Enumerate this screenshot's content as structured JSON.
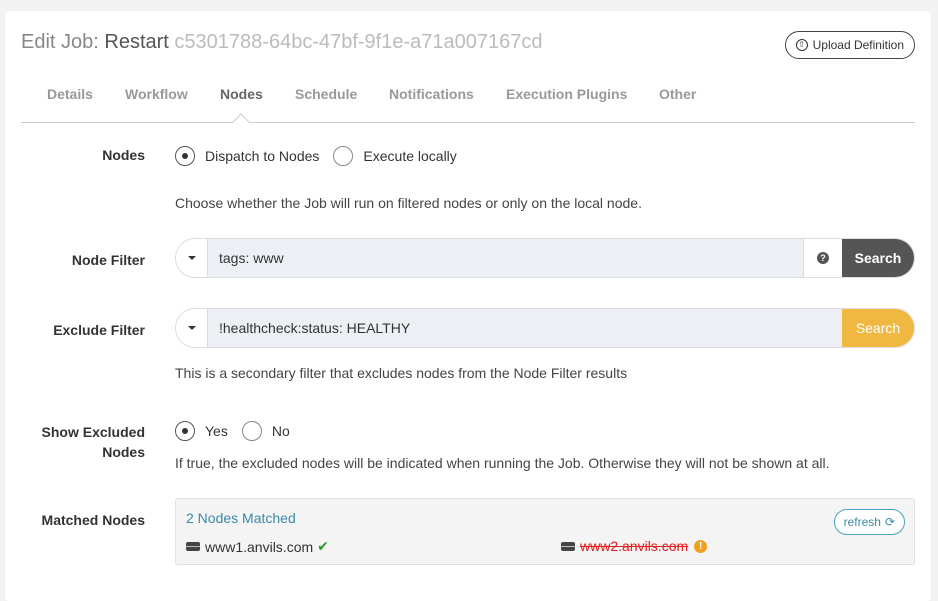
{
  "header": {
    "prefix": "Edit Job: ",
    "job_name": "Restart",
    "job_id": "c5301788-64bc-47bf-9f1e-a71a007167cd",
    "upload_label": "Upload Definition"
  },
  "tabs": [
    {
      "label": "Details"
    },
    {
      "label": "Workflow"
    },
    {
      "label": "Nodes"
    },
    {
      "label": "Schedule"
    },
    {
      "label": "Notifications"
    },
    {
      "label": "Execution Plugins"
    },
    {
      "label": "Other"
    }
  ],
  "active_tab": "Nodes",
  "nodes_section": {
    "label": "Nodes",
    "options": [
      {
        "label": "Dispatch to Nodes",
        "selected": true
      },
      {
        "label": "Execute locally",
        "selected": false
      }
    ],
    "help": "Choose whether the Job will run on filtered nodes or only on the local node."
  },
  "node_filter": {
    "label": "Node Filter",
    "value": "tags: www",
    "search_label": "Search"
  },
  "exclude_filter": {
    "label": "Exclude Filter",
    "value": "!healthcheck:status: HEALTHY",
    "search_label": "Search",
    "help": "This is a secondary filter that excludes nodes from the Node Filter results"
  },
  "show_excluded": {
    "label_line1": "Show Excluded",
    "label_line2": "Nodes",
    "options": [
      {
        "label": "Yes",
        "selected": true
      },
      {
        "label": "No",
        "selected": false
      }
    ],
    "help": "If true, the excluded nodes will be indicated when running the Job. Otherwise they will not be shown at all."
  },
  "matched_nodes": {
    "label": "Matched Nodes",
    "count_text": "2 Nodes Matched",
    "refresh_label": "refresh",
    "nodes": [
      {
        "name": "www1.anvils.com",
        "status": "ok"
      },
      {
        "name": "www2.anvils.com",
        "status": "excluded"
      }
    ]
  },
  "colors": {
    "accent": "#3a8aa8",
    "warning": "#f0b840",
    "danger": "#e02020",
    "success": "#2e9a2e"
  }
}
